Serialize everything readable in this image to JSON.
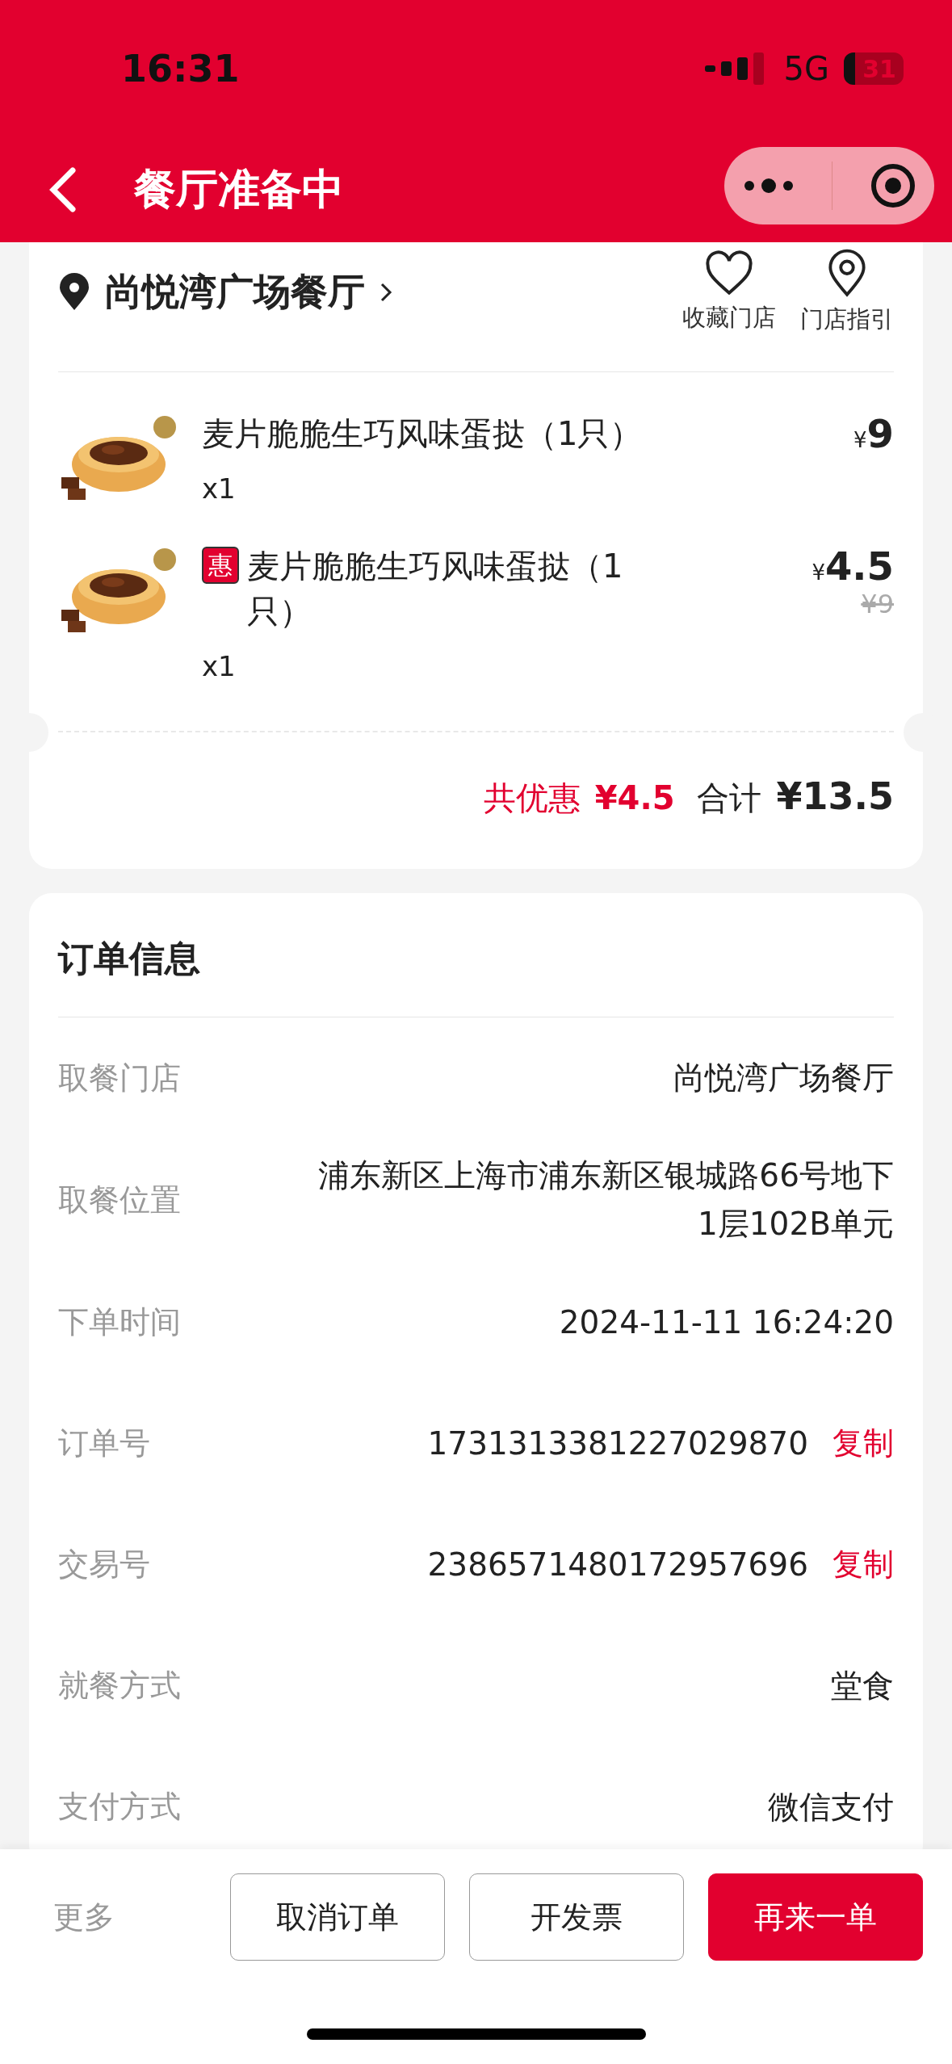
{
  "status_bar": {
    "time": "16:31",
    "network": "5G",
    "battery": "31"
  },
  "nav": {
    "title": "餐厅准备中"
  },
  "store": {
    "name": "尚悦湾广场餐厅",
    "actions": [
      {
        "kind": "favorite",
        "label": "收藏门店"
      },
      {
        "kind": "guide",
        "label": "门店指引"
      }
    ]
  },
  "items": [
    {
      "kind": "picture",
      "name": "麦片脆脆生巧风味蛋挞（1只）",
      "quantity": "x1",
      "price": "9",
      "currency": "¥"
    },
    {
      "kind": "picture",
      "badge": "惠",
      "name": "麦片脆脆生巧风味蛋挞（1只）",
      "quantity": "x1",
      "price": "4.5",
      "currency": "¥",
      "original_price": "¥9"
    }
  ],
  "summary": {
    "discount_label": "共优惠",
    "discount": "¥4.5",
    "total_label": "合计",
    "total": "¥13.5"
  },
  "order_info": {
    "title": "订单信息",
    "rows": [
      {
        "label": "取餐门店",
        "value": "尚悦湾广场餐厅"
      },
      {
        "label": "取餐位置",
        "value": "浦东新区上海市浦东新区银城路66号地下1层102B单元"
      },
      {
        "label": "下单时间",
        "value": "2024-11-11 16:24:20"
      },
      {
        "label": "订单号",
        "value": "1731313381227029870",
        "action": "复制"
      },
      {
        "label": "交易号",
        "value": "2386571480172957696",
        "action": "复制"
      },
      {
        "label": "就餐方式",
        "value": "堂食"
      },
      {
        "label": "支付方式",
        "value": "微信支付"
      }
    ]
  },
  "bottom_bar": {
    "more": "更多",
    "buttons": [
      {
        "label": "取消订单",
        "primary": false
      },
      {
        "label": "开发票",
        "primary": false
      },
      {
        "label": "再来一单",
        "primary": true
      }
    ]
  }
}
